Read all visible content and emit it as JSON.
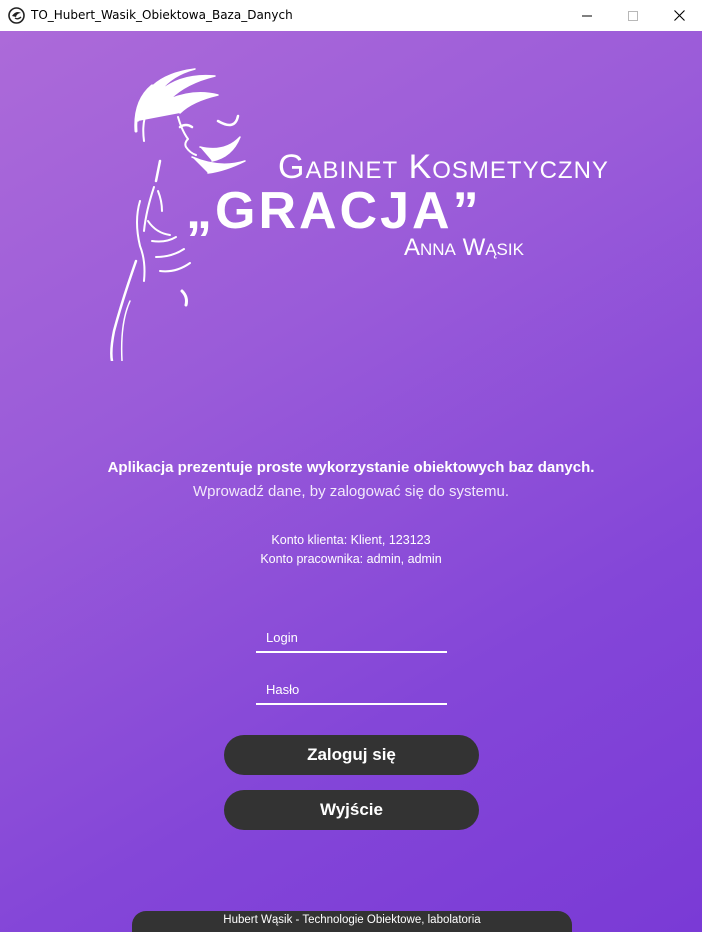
{
  "window": {
    "title": "TO_Hubert_Wasik_Obiektowa_Baza_Danych",
    "icon": "app-icon",
    "controls": [
      "minimize-icon",
      "maximize-icon",
      "close-icon"
    ]
  },
  "brand": {
    "line1": "Gabinet Kosmetyczny",
    "line2": "„GRACJA”",
    "line3": "Anna Wąsik",
    "logo_icon": "woman-silhouette-logo"
  },
  "intro": {
    "bold": "Aplikacja prezentuje proste wykorzystanie obiektowych baz danych.",
    "light": "Wprowadź dane, by zalogować się do systemu."
  },
  "accounts": {
    "client": "Konto klienta: Klient, 123123",
    "employee": "Konto pracownika: admin, admin"
  },
  "form": {
    "login_placeholder": "Login",
    "password_placeholder": "Hasło",
    "login_button": "Zaloguj się",
    "exit_button": "Wyjście"
  },
  "footer": {
    "text": "Hubert Wąsik - Technologie Obiektowe, labolatoria"
  },
  "colors": {
    "gradient_start": "#ac6ad9",
    "gradient_end": "#7a3ad6",
    "button_bg": "#333333",
    "text": "#ffffff"
  }
}
